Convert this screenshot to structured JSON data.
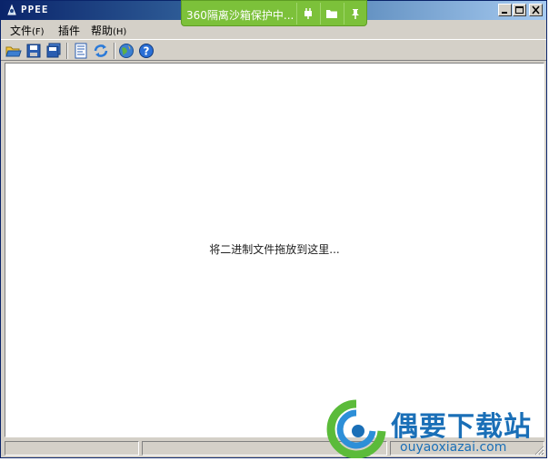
{
  "window": {
    "title": "PPEE"
  },
  "sandbox_bar": {
    "text": "360隔离沙箱保护中...",
    "color": "#7cc13a",
    "buttons": [
      "plug-icon",
      "folder-icon",
      "pin-icon"
    ]
  },
  "menu": {
    "items": [
      {
        "label": "文件",
        "accel": "(F)"
      },
      {
        "label": "插件",
        "accel": ""
      },
      {
        "label": "帮助",
        "accel": "(H)"
      }
    ]
  },
  "toolbar": {
    "icons": [
      "open-folder-icon",
      "save-icon",
      "save-all-icon",
      "pe-document-icon",
      "refresh-icon",
      "globe-icon",
      "help-icon"
    ]
  },
  "main": {
    "hint": "将二进制文件拖放到这里..."
  },
  "watermark": {
    "name": "偶要下载站",
    "url": "ouyaoxiazai.com"
  }
}
